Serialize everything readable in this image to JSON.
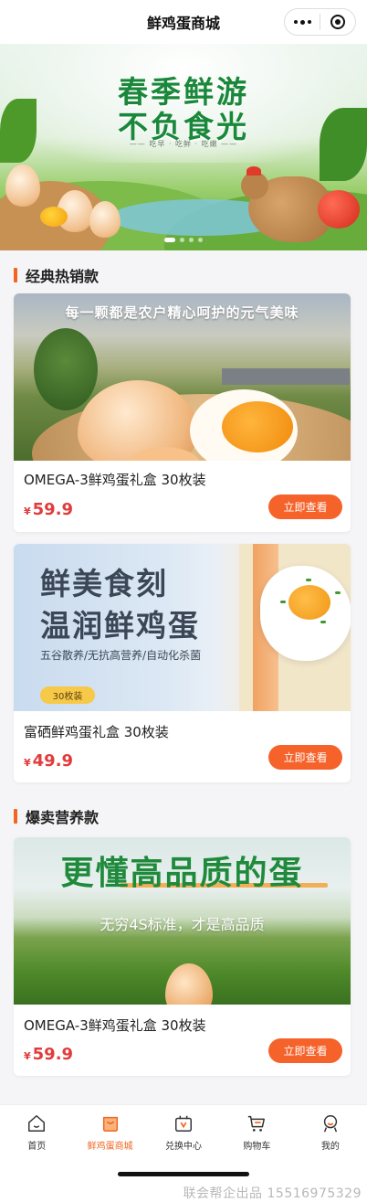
{
  "nav": {
    "title": "鲜鸡蛋商城"
  },
  "banner": {
    "title_line1": "春季鲜游",
    "title_line2": "不负食光",
    "subtitle": "—— 吃早 · 吃鲜 · 吃嫩 ——",
    "slide_count": 4,
    "active_slide": 1
  },
  "sections": [
    {
      "title": "经典热销款",
      "products": [
        {
          "image_caption": "每一颗都是农户精心呵护的元气美味",
          "name": "OMEGA-3鲜鸡蛋礼盒 30枚装",
          "currency": "¥",
          "price": "59.9",
          "button": "立即查看"
        },
        {
          "image_line1": "鲜美食刻",
          "image_line2": "温润鲜鸡蛋",
          "image_line3": "五谷散养/无抗高营养/自动化杀菌",
          "image_tag": "30枚装",
          "name": "富硒鲜鸡蛋礼盒 30枚装",
          "currency": "¥",
          "price": "49.9",
          "button": "立即查看"
        }
      ]
    },
    {
      "title": "爆卖营养款",
      "products": [
        {
          "image_line1": "更懂高品质的蛋",
          "image_line2": "无穷4S标准，才是高品质",
          "name": "OMEGA-3鲜鸡蛋礼盒 30枚装",
          "currency": "¥",
          "price": "59.9",
          "button": "立即查看"
        }
      ]
    }
  ],
  "tabbar": {
    "items": [
      {
        "label": "首页",
        "icon": "home-icon"
      },
      {
        "label": "鲜鸡蛋商城",
        "icon": "shopping-bag-icon",
        "active": true
      },
      {
        "label": "兑换中心",
        "icon": "exchange-icon"
      },
      {
        "label": "购物车",
        "icon": "cart-icon"
      },
      {
        "label": "我的",
        "icon": "user-icon"
      }
    ],
    "active_color": "#f26522"
  },
  "watermark": "联会帮企出品  15516975329",
  "colors": {
    "accent": "#f5622a",
    "price": "#e23b3b",
    "brand_green": "#19883a"
  }
}
